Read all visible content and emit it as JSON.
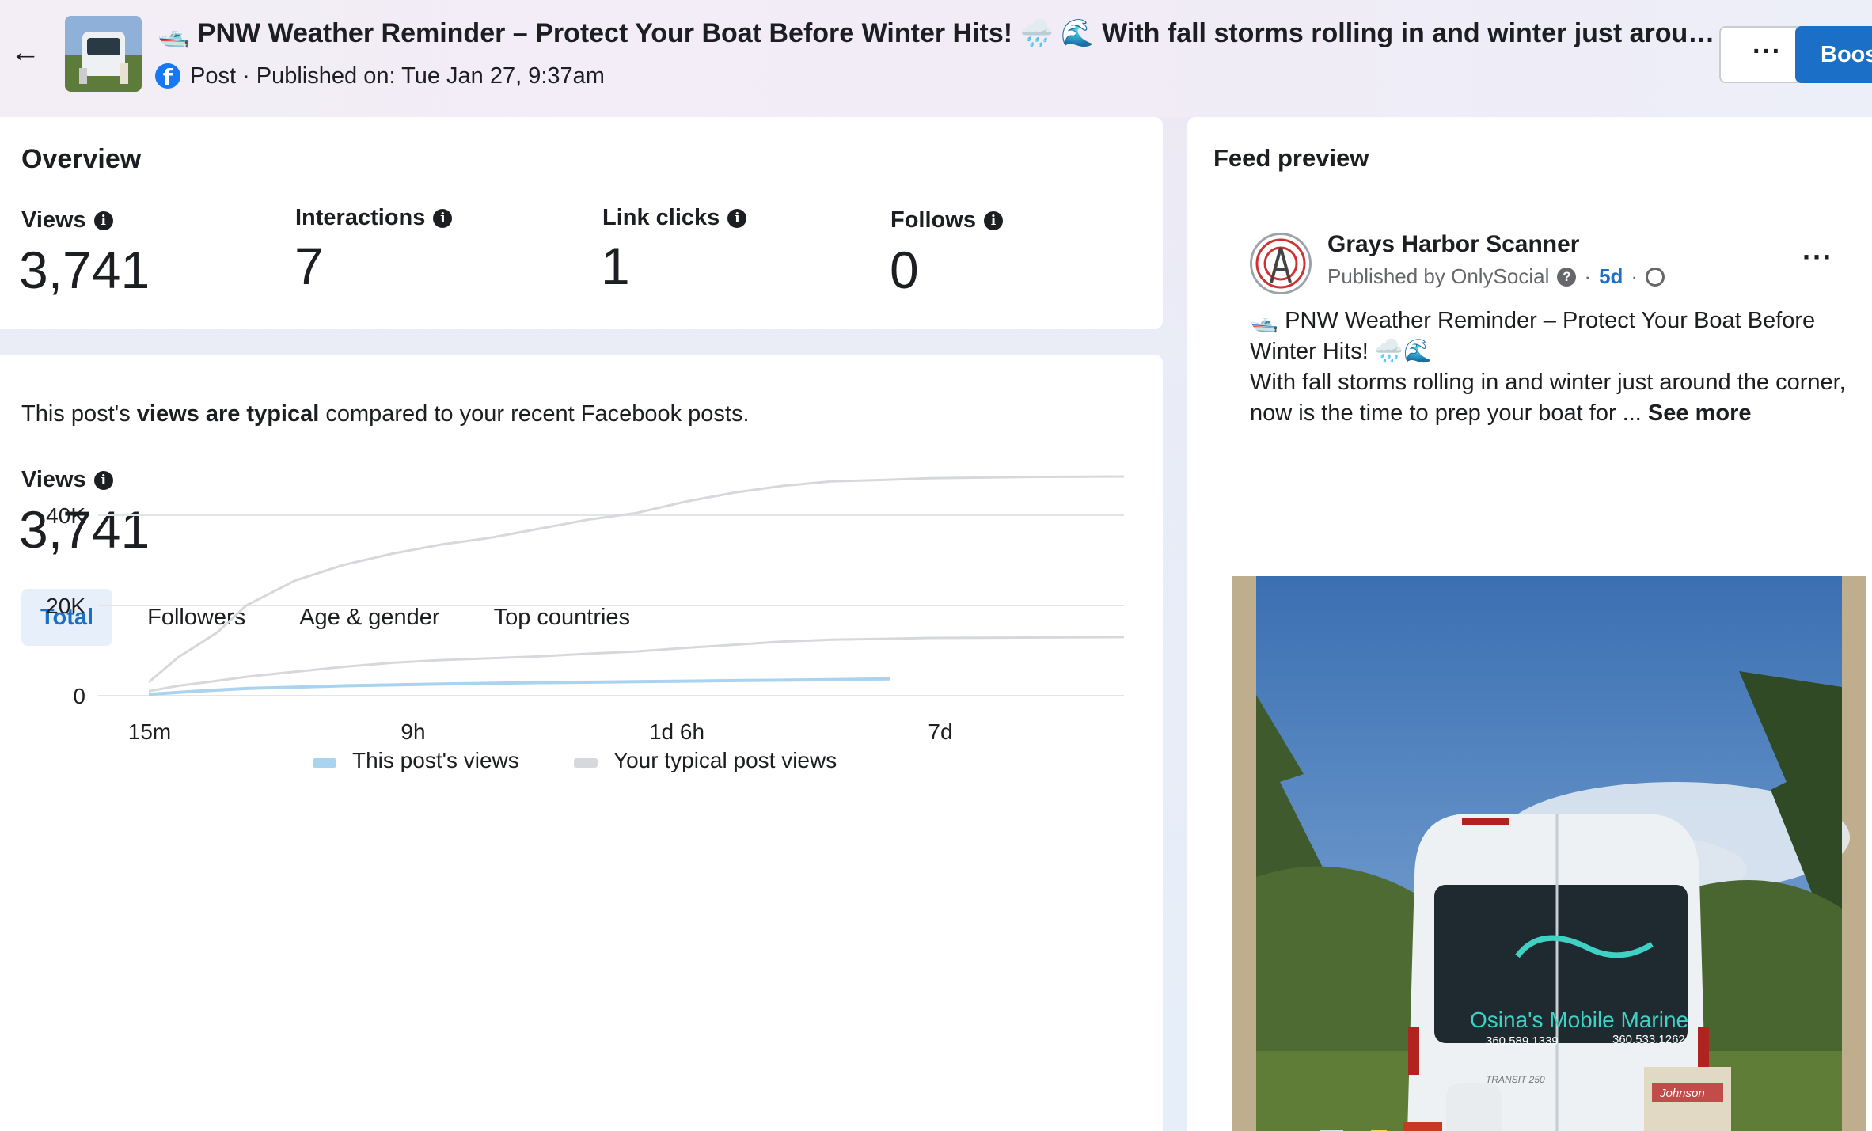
{
  "header": {
    "back_icon": "arrow-left-icon",
    "title": "🛥️ PNW Weather Reminder – Protect Your Boat Before Winter Hits! 🌧️ 🌊 With fall storms rolling in and winter just around the cor...",
    "meta": "Post · Published on: Tue Jan 27, 9:37am",
    "more_label": "···",
    "boost_label": "Boost"
  },
  "overview": {
    "title": "Overview",
    "metrics": [
      {
        "label": "Views",
        "value": "3,741"
      },
      {
        "label": "Interactions",
        "value": "7"
      },
      {
        "label": "Link clicks",
        "value": "1"
      },
      {
        "label": "Follows",
        "value": "0"
      }
    ]
  },
  "views_section": {
    "typical_prefix": "This post's ",
    "typical_bold": "views are typical",
    "typical_suffix": " compared to your recent Facebook posts.",
    "label": "Views",
    "value": "3,741",
    "tabs": [
      "Total",
      "Followers",
      "Age & gender",
      "Top countries"
    ],
    "active_tab": "Total"
  },
  "chart_data": {
    "type": "line",
    "x_ticks": [
      "15m",
      "9h",
      "1d 6h",
      "7d"
    ],
    "y_ticks": [
      "0",
      "20K",
      "40K"
    ],
    "ylim": [
      0,
      50000
    ],
    "colors": {
      "this_post": "#a9d3ef",
      "typical": "#d6d8dc"
    },
    "series": [
      {
        "name": "This post's views",
        "color": "#a9d3ef",
        "x": [
          0,
          0.05,
          0.1,
          0.2,
          0.3,
          0.4,
          0.5,
          0.6,
          0.7,
          0.76
        ],
        "y": [
          300,
          1000,
          1600,
          2200,
          2600,
          2900,
          3100,
          3350,
          3550,
          3741
        ]
      },
      {
        "name": "Your typical post views",
        "color": "#d6d8dc",
        "x": [
          0,
          0.03,
          0.06,
          0.1,
          0.15,
          0.2,
          0.25,
          0.3,
          0.35,
          0.4,
          0.45,
          0.5,
          0.55,
          0.6,
          0.65,
          0.7,
          0.75,
          0.8,
          1.0
        ],
        "y": [
          1000,
          2200,
          3000,
          4200,
          5300,
          6400,
          7300,
          7900,
          8300,
          8700,
          9300,
          9800,
          10600,
          11300,
          12000,
          12400,
          12600,
          12800,
          13000
        ]
      },
      {
        "name": "",
        "color": "#d6d8dc",
        "x": [
          0,
          0.03,
          0.07,
          0.1,
          0.15,
          0.2,
          0.25,
          0.3,
          0.35,
          0.4,
          0.45,
          0.5,
          0.55,
          0.6,
          0.65,
          0.7,
          0.75,
          0.8,
          0.9,
          1.0
        ],
        "y": [
          3000,
          8500,
          14000,
          20000,
          25500,
          29000,
          31500,
          33500,
          35000,
          37000,
          39000,
          40500,
          43000,
          45000,
          46500,
          47500,
          47800,
          48200,
          48500,
          48600
        ]
      }
    ],
    "legend": [
      "This post's views",
      "Your typical post views"
    ]
  },
  "feed": {
    "title": "Feed preview",
    "page_name": "Grays Harbor Scanner",
    "published_by": "Published by OnlySocial",
    "age": "5d",
    "more_label": "···",
    "text_line1": "🛥️ PNW Weather Reminder – Protect Your Boat Before Winter Hits! 🌧️🌊",
    "text_line2": "With fall storms rolling in and winter just around the corner, now is the time to prep your boat for ... ",
    "see_more": "See more",
    "van_business": "Osina's Mobile Marine",
    "van_phone1": "360.589.1339",
    "van_phone2": "360.533.1262",
    "van_model": "TRANSIT 250",
    "motor_brand": "Johnson"
  }
}
